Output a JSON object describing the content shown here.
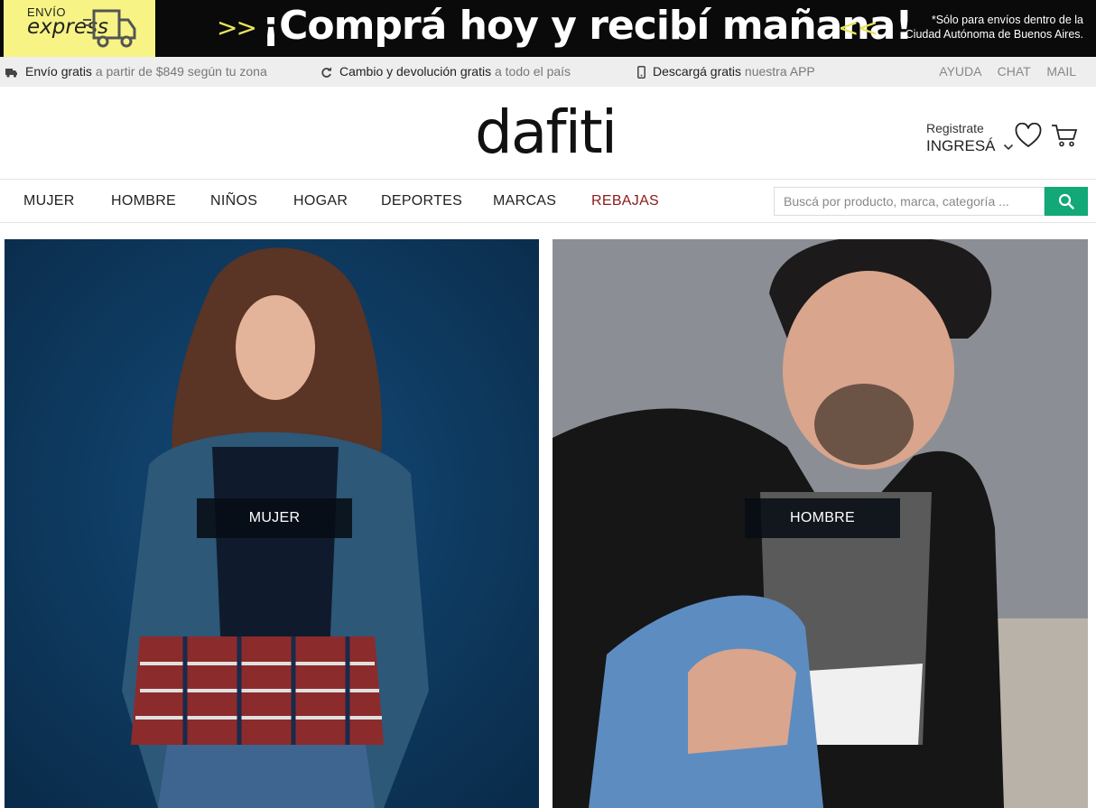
{
  "promo": {
    "express_small": "ENVÍO",
    "express_big": "express",
    "arrows_left": ">>",
    "headline": "¡Comprá hoy y recibí mañana!",
    "arrows_right": "<<",
    "note_line1": "*Sólo para envíos dentro de la",
    "note_line2": "Ciudad Autónoma de Buenos Aires.",
    "accent_color": "#f7f485"
  },
  "infobar": {
    "items": [
      {
        "icon": "truck-icon",
        "bold": "Envío gratis",
        "rest": " a partir de $849 según tu zona"
      },
      {
        "icon": "refresh-icon",
        "bold": "Cambio y devolución gratis",
        "rest": " a todo el país"
      },
      {
        "icon": "phone-icon",
        "bold": "Descargá gratis",
        "rest": " nuestra APP"
      }
    ],
    "links": [
      "AYUDA",
      "CHAT",
      "MAIL"
    ]
  },
  "header": {
    "logo": "dafiti",
    "register_label": "Registrate",
    "login_label": "INGRESÁ"
  },
  "nav": {
    "items": [
      "MUJER",
      "HOMBRE",
      "NIÑOS",
      "HOGAR",
      "DEPORTES",
      "MARCAS",
      "REBAJAS"
    ],
    "sale_color": "#8b1a1a"
  },
  "search": {
    "placeholder": "Buscá por producto, marca, categoría ...",
    "button_color": "#12a878"
  },
  "hero": {
    "left_label": "MUJER",
    "right_label": "HOMBRE"
  }
}
